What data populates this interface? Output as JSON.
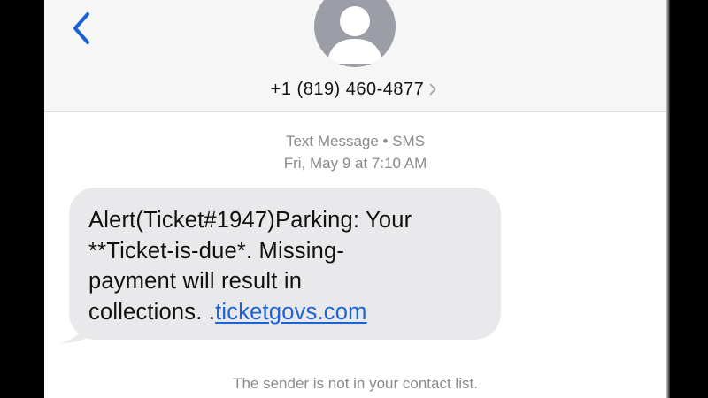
{
  "header": {
    "back_icon": "chevron-left-icon",
    "avatar_icon": "person-silhouette-icon",
    "contact_number": "+1 (819) 460-4877",
    "contact_chevron_icon": "chevron-right-icon"
  },
  "conversation": {
    "service_label": "Text Message • SMS",
    "timestamp": "Fri, May 9 at 7:10 AM",
    "message": {
      "line1": "Alert(Ticket#1947)Parking: Your",
      "line2": "**Ticket-is-due*. Missing-",
      "line3": "payment will result in",
      "line4_prefix": "collections. .",
      "link": "ticketgovs.com"
    },
    "footer_note": "The sender is not in your contact list."
  },
  "colors": {
    "accent": "#1a62d6",
    "bubble": "#e9e9eb",
    "meta_text": "#8a8a8e",
    "avatar": "#9b9ea6"
  }
}
